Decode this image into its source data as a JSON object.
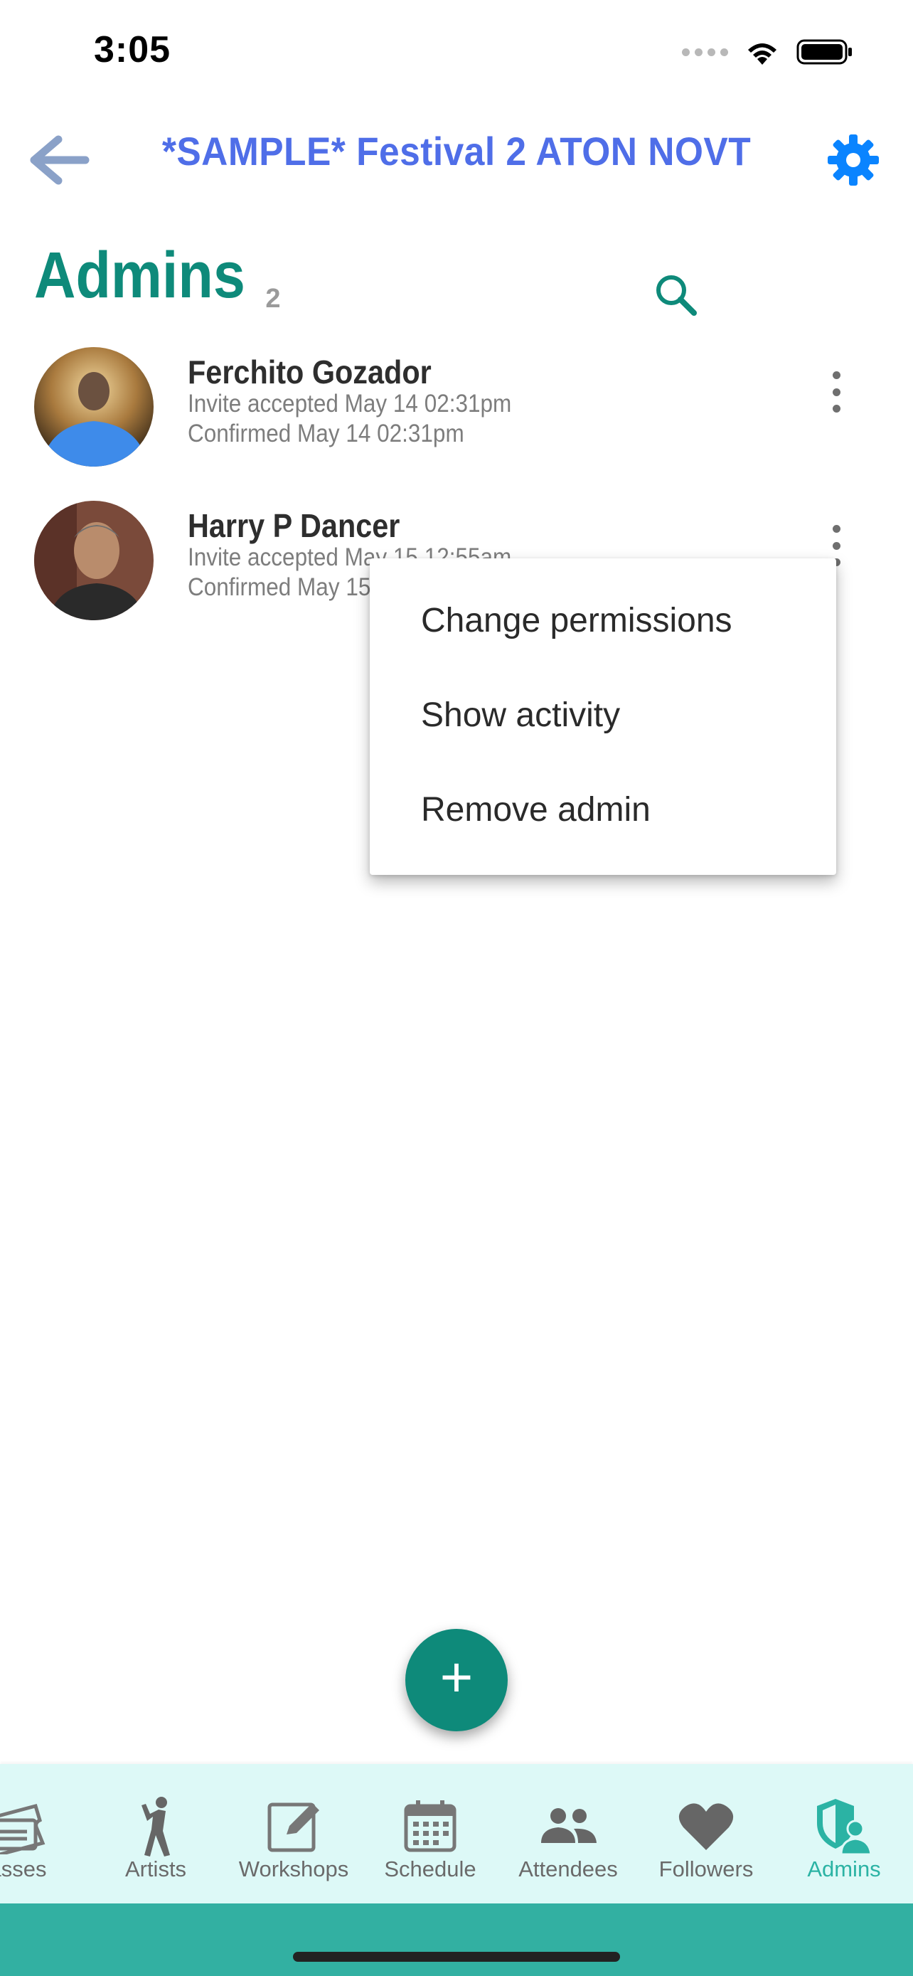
{
  "status_bar": {
    "time": "3:05"
  },
  "header": {
    "title": "*SAMPLE* Festival 2 ATON NOVT"
  },
  "section": {
    "title": "Admins",
    "count": "2"
  },
  "admins": [
    {
      "name": "Ferchito Gozador",
      "invite": "Invite accepted May 14 02:31pm",
      "confirmed": "Confirmed May 14 02:31pm"
    },
    {
      "name": "Harry P Dancer",
      "invite": "Invite accepted May 15 12:55am",
      "confirmed": "Confirmed May 15"
    }
  ],
  "menu": {
    "items": [
      {
        "label": "Change permissions"
      },
      {
        "label": "Show activity"
      },
      {
        "label": "Remove admin"
      }
    ]
  },
  "fab": {
    "label": "+"
  },
  "nav": {
    "items": [
      {
        "label": "asses",
        "icon": "tickets-icon"
      },
      {
        "label": "Artists",
        "icon": "dancer-icon"
      },
      {
        "label": "Workshops",
        "icon": "edit-icon"
      },
      {
        "label": "Schedule",
        "icon": "calendar-icon"
      },
      {
        "label": "Attendees",
        "icon": "people-icon"
      },
      {
        "label": "Followers",
        "icon": "heart-icon"
      },
      {
        "label": "Admins",
        "icon": "admin-shield-icon",
        "active": true
      }
    ]
  },
  "colors": {
    "accent": "#0e8a7a",
    "title_blue": "#4f6ee8",
    "settings_blue": "#0a84ff",
    "nav_background": "#ddf9f7",
    "nav_active": "#2bb3a4"
  }
}
